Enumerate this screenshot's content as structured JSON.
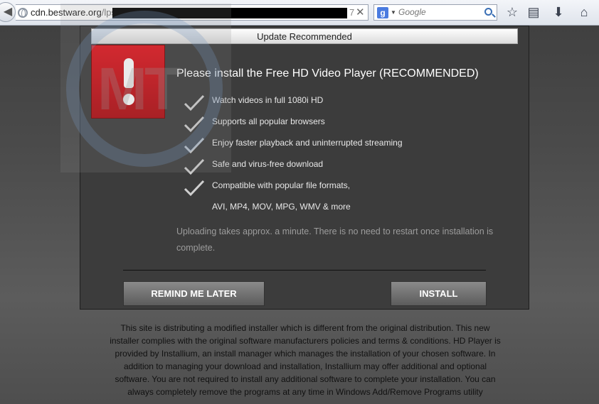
{
  "browser": {
    "url_domain": "cdn.bestware.org",
    "url_path": "/lps/",
    "url_tail": "7",
    "search_placeholder": "Google",
    "search_engine_icon": "google-icon"
  },
  "watermark": {
    "letters": "MT"
  },
  "dialog": {
    "header": "Update Recommended",
    "title": "Please install the Free HD Video Player (RECOMMENDED)",
    "features": [
      "Watch videos in full 1080i HD",
      "Supports all popular browsers",
      "Enjoy faster playback and uninterrupted streaming",
      "Safe and virus-free download",
      "Compatible with popular file formats,"
    ],
    "formats_line": "AVI, MP4, MOV, MPG, WMV & more",
    "note": "Uploading takes approx. a minute. There is no need to restart once installation is complete.",
    "remind_button": "REMIND ME LATER",
    "install_button": "INSTALL",
    "warning_icon_color": "#d8101a"
  },
  "disclaimer": "This site is distributing a modified installer which is different from the original distribution. This new installer complies with the original software manufacturers policies and terms & conditions. HD Player is provided by Installium, an install manager which manages the installation of your chosen software. In addition to managing your download and installation, Installium may offer additional and optional software. You are not required to install any additional software to complete your installation. You can always completely remove the programs at any time in Windows Add/Remove Programs utility"
}
